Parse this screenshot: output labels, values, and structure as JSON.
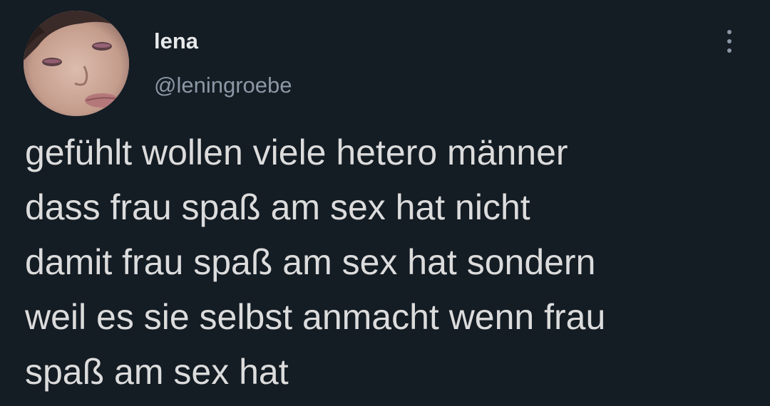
{
  "author": {
    "display_name": "lena",
    "handle": "@leningroebe",
    "avatar_icon": "profile-photo"
  },
  "actions": {
    "more_icon": "more-options-icon"
  },
  "tweet": {
    "lines": [
      "gefühlt wollen viele hetero männer",
      "dass frau spaß am sex hat nicht",
      "damit frau spaß am sex hat sondern",
      "weil es sie selbst anmacht wenn frau",
      "spaß am sex hat"
    ]
  },
  "colors": {
    "background": "#141c24",
    "text": "#dcdcdc",
    "secondary_text": "#8b98a5"
  }
}
